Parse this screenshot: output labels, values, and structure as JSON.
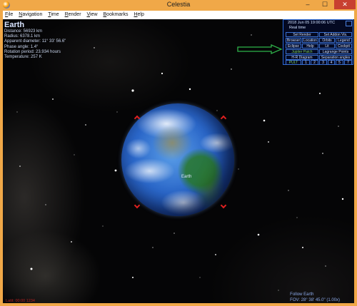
{
  "window": {
    "title": "Celestia",
    "min": "–",
    "max": "☐",
    "close": "✕"
  },
  "menu": [
    "File",
    "Navigation",
    "Time",
    "Render",
    "View",
    "Bookmarks",
    "Help"
  ],
  "info": {
    "name": "Earth",
    "lines": [
      "Distance: 56923 km",
      "Radius: 6378.1 km",
      "Apparent diameter: 11° 33' 56.6\"",
      "Phase angle: 1.4°",
      "Rotation period: 23.934 hours",
      "Temperature: 257 K"
    ]
  },
  "earth_label": "Earth",
  "panel": {
    "datetime": "2018 Jun 05 19:00:06 UTC",
    "realtime": "Real time",
    "buttons": [
      {
        "label": "Set Render",
        "color": "default"
      },
      {
        "label": "Set Addon Vis.",
        "color": "default"
      },
      {
        "label": "Browser",
        "color": "default"
      },
      {
        "label": "Location",
        "color": "default"
      },
      {
        "label": "Orbits",
        "color": "default"
      },
      {
        "label": "Legend",
        "color": "default"
      },
      {
        "label": "Eclipse",
        "color": "default"
      },
      {
        "label": "Help",
        "color": "default"
      },
      {
        "label": "Lit",
        "color": "default"
      },
      {
        "label": "Cockpit",
        "color": "default"
      },
      {
        "label": "Jupiter Patch",
        "color": "green"
      },
      {
        "label": "Lagrange Points",
        "color": "default"
      },
      {
        "label": "H-R Diagram",
        "color": "default"
      },
      {
        "label": "Separation angles",
        "color": "default"
      },
      {
        "label": "PULT",
        "color": "green"
      },
      {
        "label": "1",
        "color": "default"
      },
      {
        "label": "2",
        "color": "default"
      },
      {
        "label": "3",
        "color": "default"
      },
      {
        "label": "4",
        "color": "default"
      },
      {
        "label": "5",
        "color": "default"
      },
      {
        "label": "7",
        "color": "default"
      }
    ]
  },
  "status": {
    "left": "Latit: 00:00  1234",
    "follow": "Follow Earth",
    "fov": "FOV: 28° 38' 45.0\" (1.00x)"
  },
  "colors": {
    "frame": "#f0a848",
    "panel_border": "#2a6ad8",
    "arrow": "#2fb34a",
    "marker": "#e02020"
  }
}
